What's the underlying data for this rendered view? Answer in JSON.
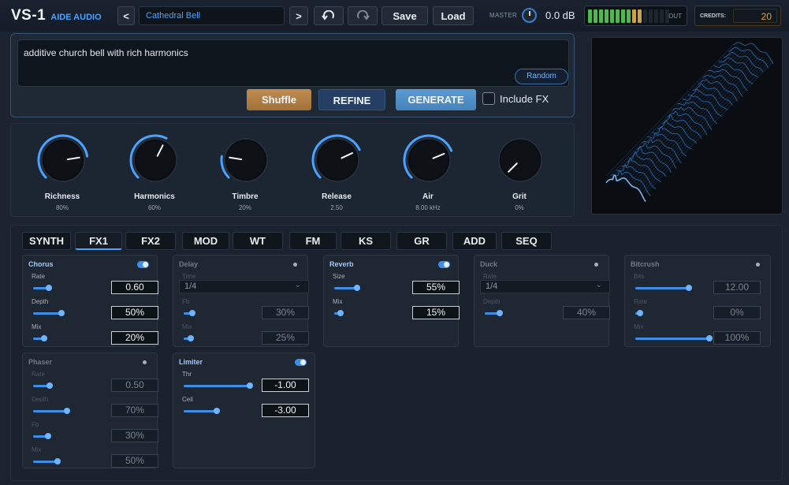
{
  "app": {
    "name": "VS-1",
    "subtitle": "AIDE AUDIO"
  },
  "toolbar": {
    "prev_label": "<",
    "next_label": ">",
    "preset_name": "Cathedral Bell",
    "undo_icon": "undo-icon",
    "redo_icon": "redo-icon",
    "save_label": "Save",
    "load_label": "Load",
    "master_label": "MASTER",
    "master_db": "0.0 dB",
    "meter_out_label": "OUT",
    "meter_level": 10,
    "meter_segments": 18,
    "credits_label": "CREDITS:",
    "credits_value": "20"
  },
  "prompt": {
    "text": "additive church bell with rich harmonics",
    "random_label": "Random",
    "shuffle_label": "Shuffle",
    "refine_label": "REFINE",
    "generate_label": "GENERATE",
    "include_fx_label": "Include FX",
    "include_fx_checked": false
  },
  "macros": [
    {
      "name": "Richness",
      "value": "80%",
      "level": 0.8
    },
    {
      "name": "Harmonics",
      "value": "60%",
      "level": 0.6
    },
    {
      "name": "Timbre",
      "value": "20%",
      "level": 0.2
    },
    {
      "name": "Release",
      "value": "2.50",
      "level": 0.74
    },
    {
      "name": "Air",
      "value": "8.00 kHz",
      "level": 0.75
    },
    {
      "name": "Grit",
      "value": "0%",
      "level": 0.0
    }
  ],
  "tabs": [
    "SYNTH",
    "FX1",
    "FX2",
    "MOD",
    "WT",
    "FM",
    "KS",
    "GR",
    "ADD",
    "SEQ"
  ],
  "active_tab": "FX1",
  "fx": {
    "chorus": {
      "title": "Chorus",
      "enabled": true,
      "params": [
        {
          "label": "Rate",
          "value": "0.60",
          "level": 0.28
        },
        {
          "label": "Depth",
          "value": "50%",
          "level": 0.5
        },
        {
          "label": "Mix",
          "value": "20%",
          "level": 0.2
        }
      ]
    },
    "delay": {
      "title": "Delay",
      "enabled": false,
      "time_label": "Time",
      "time_value": "1/4",
      "params": [
        {
          "label": "Fb",
          "value": "30%",
          "level": 0.3
        },
        {
          "label": "Mix",
          "value": "25%",
          "level": 0.25
        }
      ]
    },
    "reverb": {
      "title": "Reverb",
      "enabled": true,
      "params": [
        {
          "label": "Size",
          "value": "55%",
          "level": 0.55
        },
        {
          "label": "Mix",
          "value": "15%",
          "level": 0.15
        }
      ]
    },
    "duck": {
      "title": "Duck",
      "enabled": false,
      "rate_label": "Rate",
      "rate_value": "1/4",
      "params": [
        {
          "label": "Depth",
          "value": "40%",
          "level": 0.4
        }
      ]
    },
    "bitcrush": {
      "title": "Bitcrush",
      "enabled": false,
      "params": [
        {
          "label": "Bits",
          "value": "12.00",
          "level": 0.72
        },
        {
          "label": "Rate",
          "value": "0%",
          "level": 0.0
        },
        {
          "label": "Mix",
          "value": "100%",
          "level": 1.0
        }
      ]
    },
    "phaser": {
      "title": "Phaser",
      "enabled": false,
      "params": [
        {
          "label": "Rate",
          "value": "0.50",
          "level": 0.34
        },
        {
          "label": "Depth",
          "value": "70%",
          "level": 0.7
        },
        {
          "label": "Fb",
          "value": "30%",
          "level": 0.3
        },
        {
          "label": "Mix",
          "value": "50%",
          "level": 0.5
        }
      ]
    },
    "limiter": {
      "title": "Limiter",
      "enabled": true,
      "params": [
        {
          "label": "Thr",
          "value": "-1.00",
          "level": 0.96
        },
        {
          "label": "Ceil",
          "value": "-3.00",
          "level": 0.48
        }
      ]
    }
  },
  "colors": {
    "accent": "#4aa3ff",
    "shuffle": "#b58245",
    "refine": "#2a4a70",
    "generate": "#4f8fc9"
  }
}
